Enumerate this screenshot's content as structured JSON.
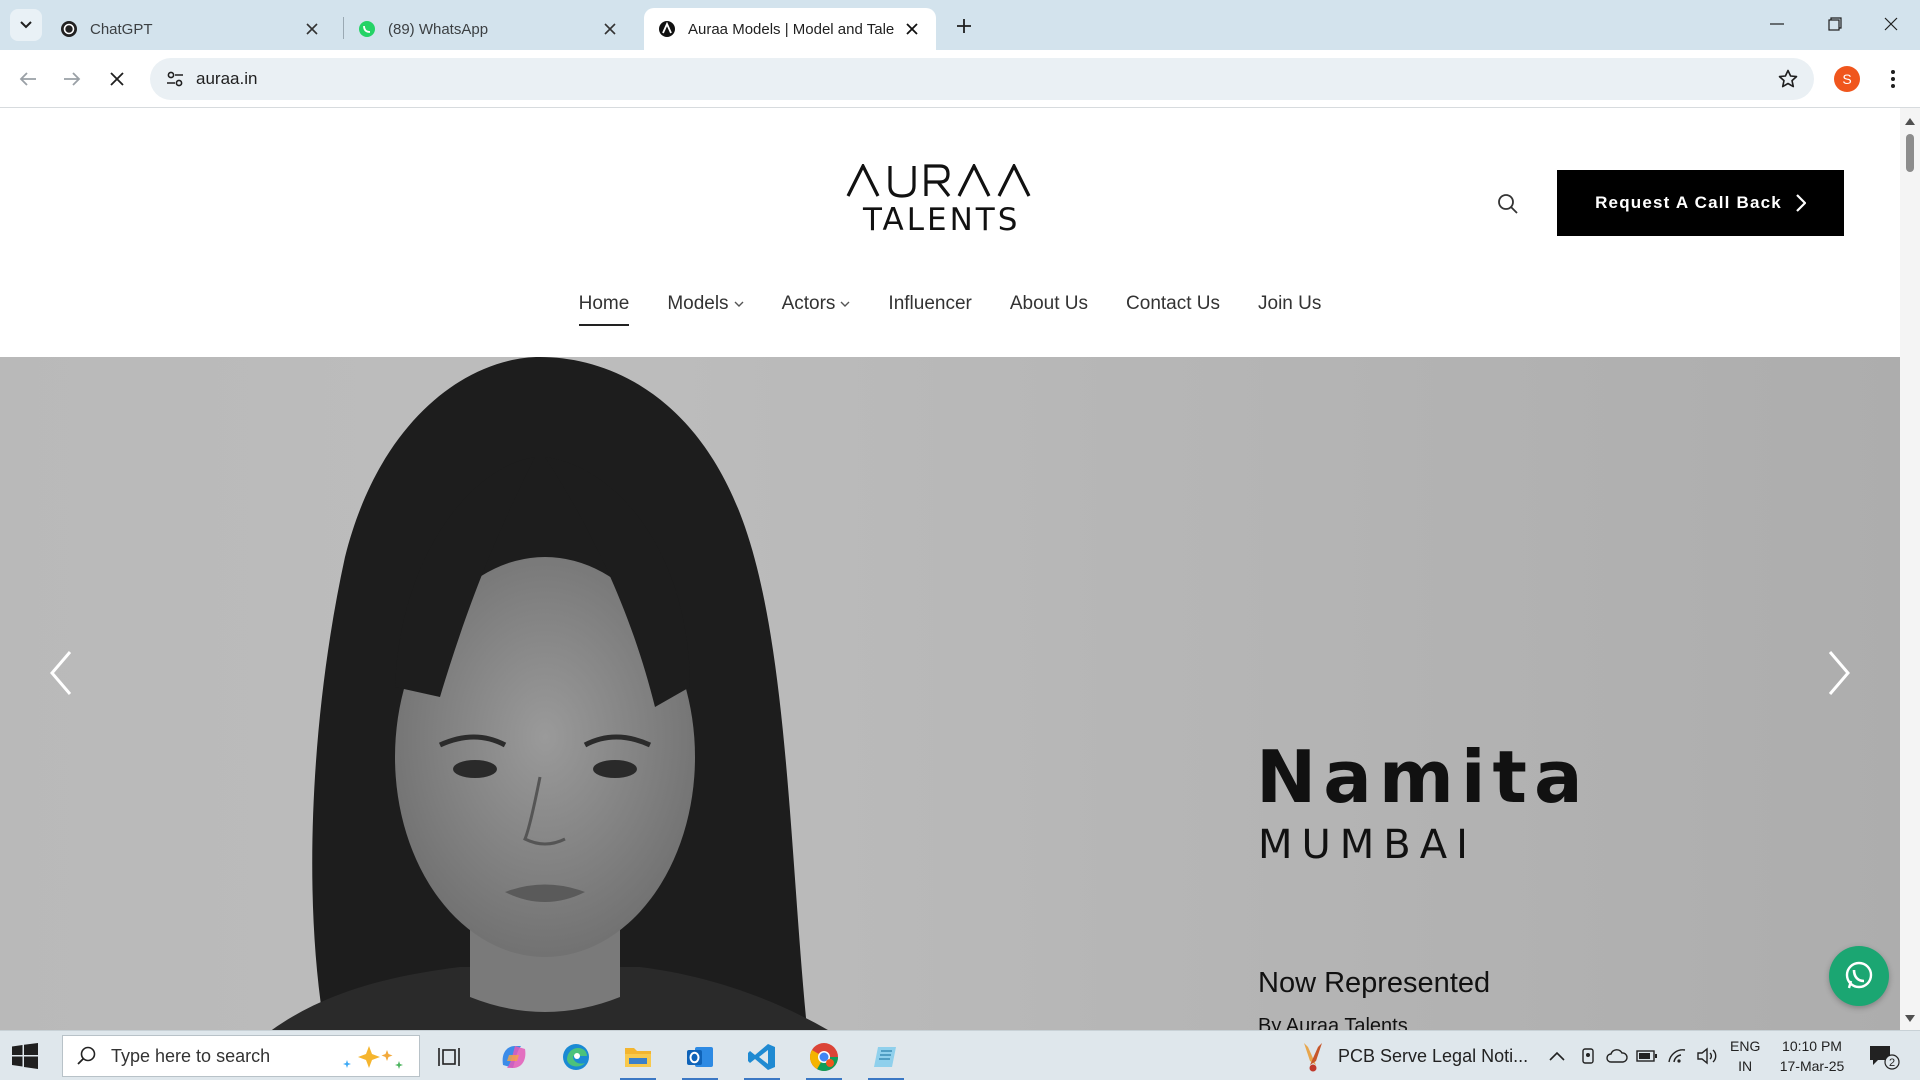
{
  "browser": {
    "tabs": [
      {
        "title": "ChatGPT",
        "icon": "chatgpt-icon",
        "active": false
      },
      {
        "title": "(89) WhatsApp",
        "icon": "whatsapp-icon",
        "active": false
      },
      {
        "title": "Auraa Models | Model and Talent",
        "icon": "auraa-icon",
        "active": true
      }
    ],
    "url": "auraa.in",
    "profile_initial": "S",
    "profile_color": "#f0561d"
  },
  "site": {
    "logo": {
      "line1": "AURAA",
      "line2": "TALENTS"
    },
    "cta_label": "Request A Call Back",
    "nav": [
      {
        "label": "Home",
        "active": true,
        "dropdown": false
      },
      {
        "label": "Models",
        "active": false,
        "dropdown": true
      },
      {
        "label": "Actors",
        "active": false,
        "dropdown": true
      },
      {
        "label": "Influencer",
        "active": false,
        "dropdown": false
      },
      {
        "label": "About Us",
        "active": false,
        "dropdown": false
      },
      {
        "label": "Contact Us",
        "active": false,
        "dropdown": false
      },
      {
        "label": "Join Us",
        "active": false,
        "dropdown": false
      }
    ],
    "hero": {
      "name": "Namita",
      "city": "MUMBAI",
      "headline": "Now Represented",
      "sub": "By Auraa Talents"
    },
    "whatsapp_color": "#1ba672"
  },
  "taskbar": {
    "search_placeholder": "Type here to search",
    "news": "PCB Serve Legal Noti...",
    "lang_line1": "ENG",
    "lang_line2": "IN",
    "time": "10:10 PM",
    "date": "17-Mar-25",
    "notifications": "2"
  }
}
